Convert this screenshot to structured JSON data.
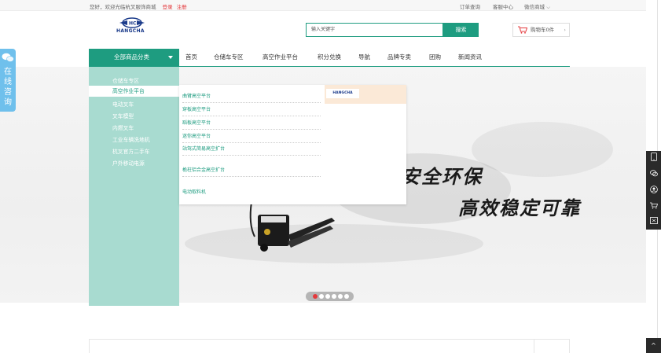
{
  "topbar": {
    "welcome": "您好，欢迎光临杭叉服饰商城",
    "login": "登录",
    "register": "注册",
    "links": [
      "订单查询",
      "客服中心",
      "微信商城 ⌵"
    ]
  },
  "header": {
    "brand": "HANGCHA",
    "search_placeholder": "输入关键字",
    "search_button": "搜索",
    "cart_label": "购物车0件",
    "cart_chevron": "›"
  },
  "nav": {
    "all_categories": "全部商品分类",
    "items": [
      "首页",
      "仓储车专区",
      "高空作业平台",
      "积分兑换",
      "导航",
      "品牌专卖",
      "团购",
      "新闻资讯"
    ]
  },
  "categories": [
    "仓储车专区",
    "高空作业平台",
    "电动叉车",
    "叉车模型",
    "内燃叉车",
    "工业车辆洗地机",
    "杭叉官方二手车",
    "户外移动电源"
  ],
  "submenu": {
    "items": [
      "曲臂高空平台",
      "穿板高空平台",
      "蹈板高空平台",
      "迷你高空平台",
      "站驾式简易高空扩台",
      "桅柱铝合金高空扩台",
      "电动取料机"
    ],
    "brand_badge": "HANGCHA"
  },
  "banner": {
    "slogan_line1": "安全环保",
    "slogan_line2": "高效稳定可靠",
    "dot_count": 6,
    "active_dot": 0
  },
  "float_left": {
    "label": "在线咨询"
  },
  "rightbar": {
    "icons": [
      "phone-icon",
      "chat-icon",
      "user-icon",
      "cart-icon",
      "coupon-icon"
    ],
    "top_glyph": "^"
  }
}
